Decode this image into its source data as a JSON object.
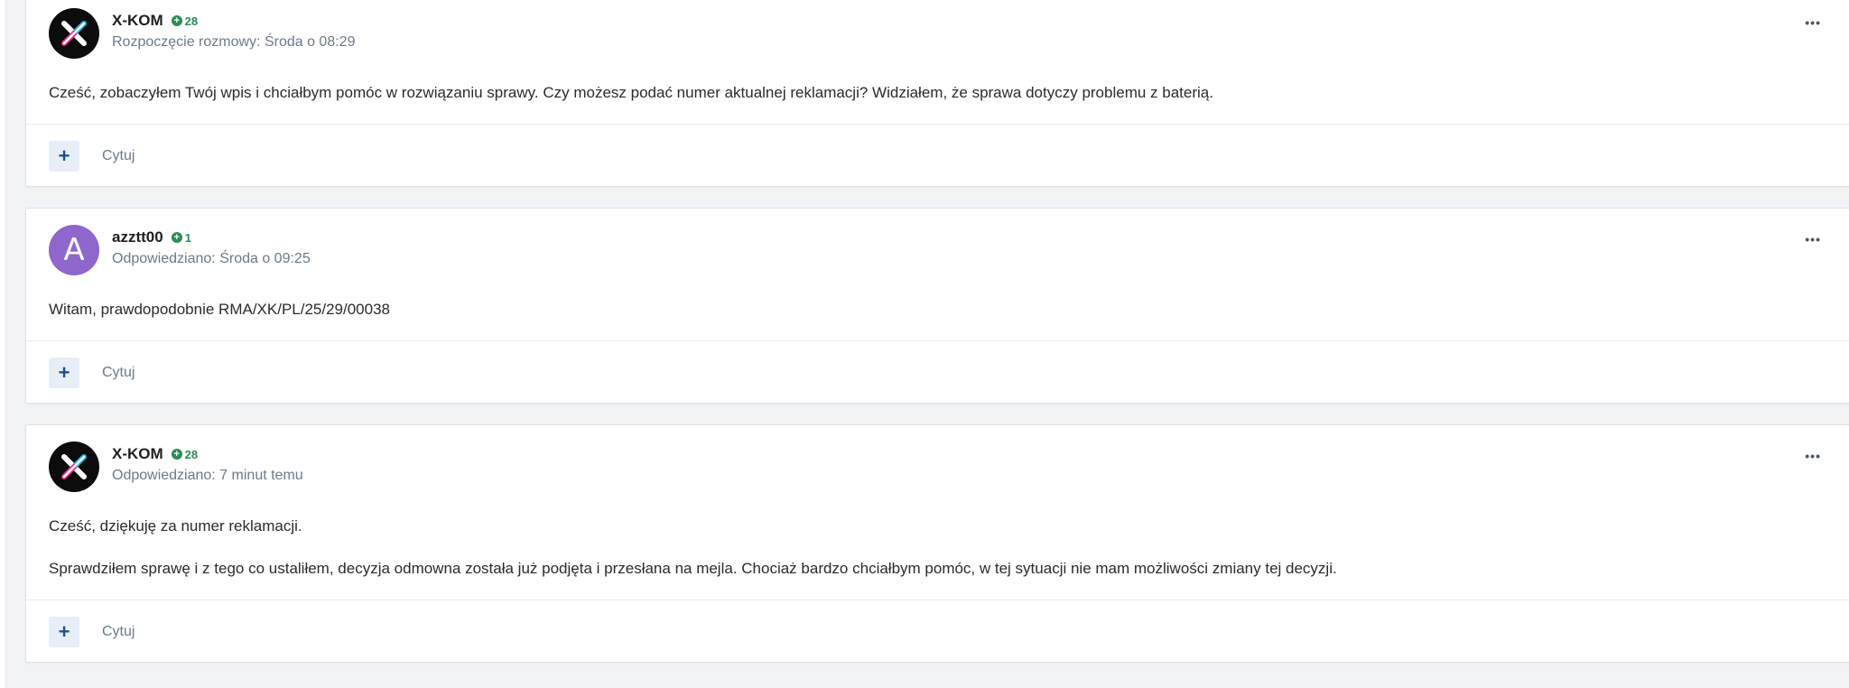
{
  "posts": [
    {
      "author": "X-KOM",
      "reputation": "28",
      "meta": "Rozpoczęcie rozmowy: Środa o 08:29",
      "avatar": "x-kom-logo",
      "paragraphs": [
        "Cześć, zobaczyłem Twój wpis i chciałbym pomóc w rozwiązaniu sprawy. Czy możesz podać numer aktualnej reklamacji? Widziałem, że sprawa dotyczy problemu z baterią."
      ],
      "quote_label": "Cytuj",
      "plus_label": "+",
      "menu_label": "•••"
    },
    {
      "author": "azztt00",
      "reputation": "1",
      "meta": "Odpowiedziano: Środa o 09:25",
      "avatar_letter": "A",
      "avatar_color": "#8e66cc",
      "paragraphs": [
        "Witam, prawdopodobnie RMA/XK/PL/25/29/00038"
      ],
      "quote_label": "Cytuj",
      "plus_label": "+",
      "menu_label": "•••"
    },
    {
      "author": "X-KOM",
      "reputation": "28",
      "meta": "Odpowiedziano: 7 minut temu",
      "avatar": "x-kom-logo",
      "paragraphs": [
        "Cześć, dziękuję za numer reklamacji.",
        "Sprawdziłem sprawę i z tego co ustaliłem, decyzja odmowna została już podjęta i przesłana na mejla. Chociaż bardzo chciałbym pomóc, w tej sytuacji nie mam możliwości zmiany tej decyzji."
      ],
      "quote_label": "Cytuj",
      "plus_label": "+",
      "menu_label": "•••"
    }
  ],
  "colors": {
    "reputation_green": "#2e8b57",
    "meta_gray": "#6c7a8a",
    "plus_button_bg": "#e6eef7",
    "plus_button_fg": "#1e4f8a"
  },
  "icons": {
    "reputation": "plus-circle-icon",
    "menu": "ellipsis-icon",
    "add": "plus-icon"
  }
}
